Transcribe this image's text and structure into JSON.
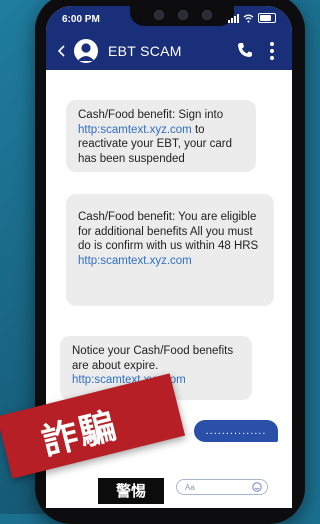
{
  "status_bar": {
    "time": "6:00 PM"
  },
  "app_bar": {
    "contact_name": "EBT SCAM"
  },
  "messages": [
    {
      "text_parts": [
        "Cash/Food benefit:  Sign into ",
        "http:scamtext.xyz.com",
        " to reactivate your EBT, your card has been suspended"
      ]
    },
    {
      "text_parts": [
        "Cash/Food benefit: You are eligible for additional benefits All you must do is confirm with us within 48 HRS",
        "http:scamtext.xyz.com"
      ]
    },
    {
      "text_parts": [
        "Notice your Cash/Food benefits are about expire.",
        "http:scamtext.xyz.com"
      ]
    }
  ],
  "sent_message": {
    "text": "..............."
  },
  "composer": {
    "placeholder": "Aa"
  },
  "stamp": {
    "label": "詐騙",
    "sublabel": "警惕"
  },
  "colors": {
    "header": "#1a2f7a",
    "link": "#2f6fc4",
    "stamp": "#b51f25",
    "background": "#1b6f8f"
  }
}
